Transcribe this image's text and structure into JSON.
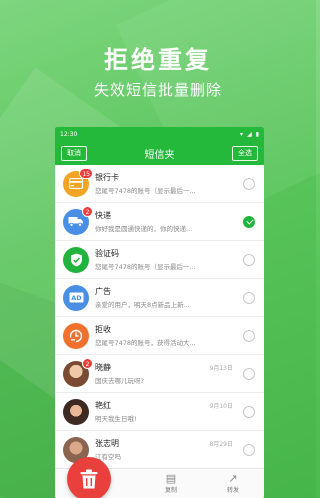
{
  "headline": "拒绝重复",
  "subline": "失效短信批量删除",
  "status": {
    "time": "12:30"
  },
  "nav": {
    "cancel": "取消",
    "title": "短信夹",
    "select_all": "全选"
  },
  "messages": [
    {
      "title": "银行卡",
      "date": "",
      "preview": "您尾号7478的账号（显示最后一...",
      "badge": "15",
      "checked": false,
      "icon": "bank-card-icon",
      "color": "#f4a423"
    },
    {
      "title": "快递",
      "date": "",
      "preview": "你好我是圆通快递的，你的快递...",
      "badge": "2",
      "checked": true,
      "icon": "delivery-truck-icon",
      "color": "#4a8fe6"
    },
    {
      "title": "验证码",
      "date": "",
      "preview": "您尾号7478的账号（显示最后一...",
      "badge": "",
      "checked": false,
      "icon": "shield-check-icon",
      "color": "#21b33c"
    },
    {
      "title": "广告",
      "date": "",
      "preview": "亲爱的用户，明天8点新品上新...",
      "badge": "",
      "checked": false,
      "icon": "ad-icon",
      "color": "#4a8fe6"
    },
    {
      "title": "拒收",
      "date": "",
      "preview": "您尾号7478的账号，获得活动大...",
      "badge": "",
      "checked": false,
      "icon": "reject-icon",
      "color": "#f0712e"
    },
    {
      "title": "晓静",
      "date": "9月13日",
      "preview": "国庆去哪儿玩呀?",
      "badge": "2",
      "checked": false,
      "icon": "avatar",
      "color": "#c98a6a"
    },
    {
      "title": "艳红",
      "date": "9月10日",
      "preview": "明天我生日哦!",
      "badge": "",
      "checked": false,
      "icon": "avatar",
      "color": "#6b4a3a"
    },
    {
      "title": "张志明",
      "date": "8月29日",
      "preview": "江有空吗",
      "badge": "",
      "checked": false,
      "icon": "avatar",
      "color": "#b88a6e"
    }
  ],
  "bottom": {
    "copy": "复制",
    "forward": "转发"
  }
}
